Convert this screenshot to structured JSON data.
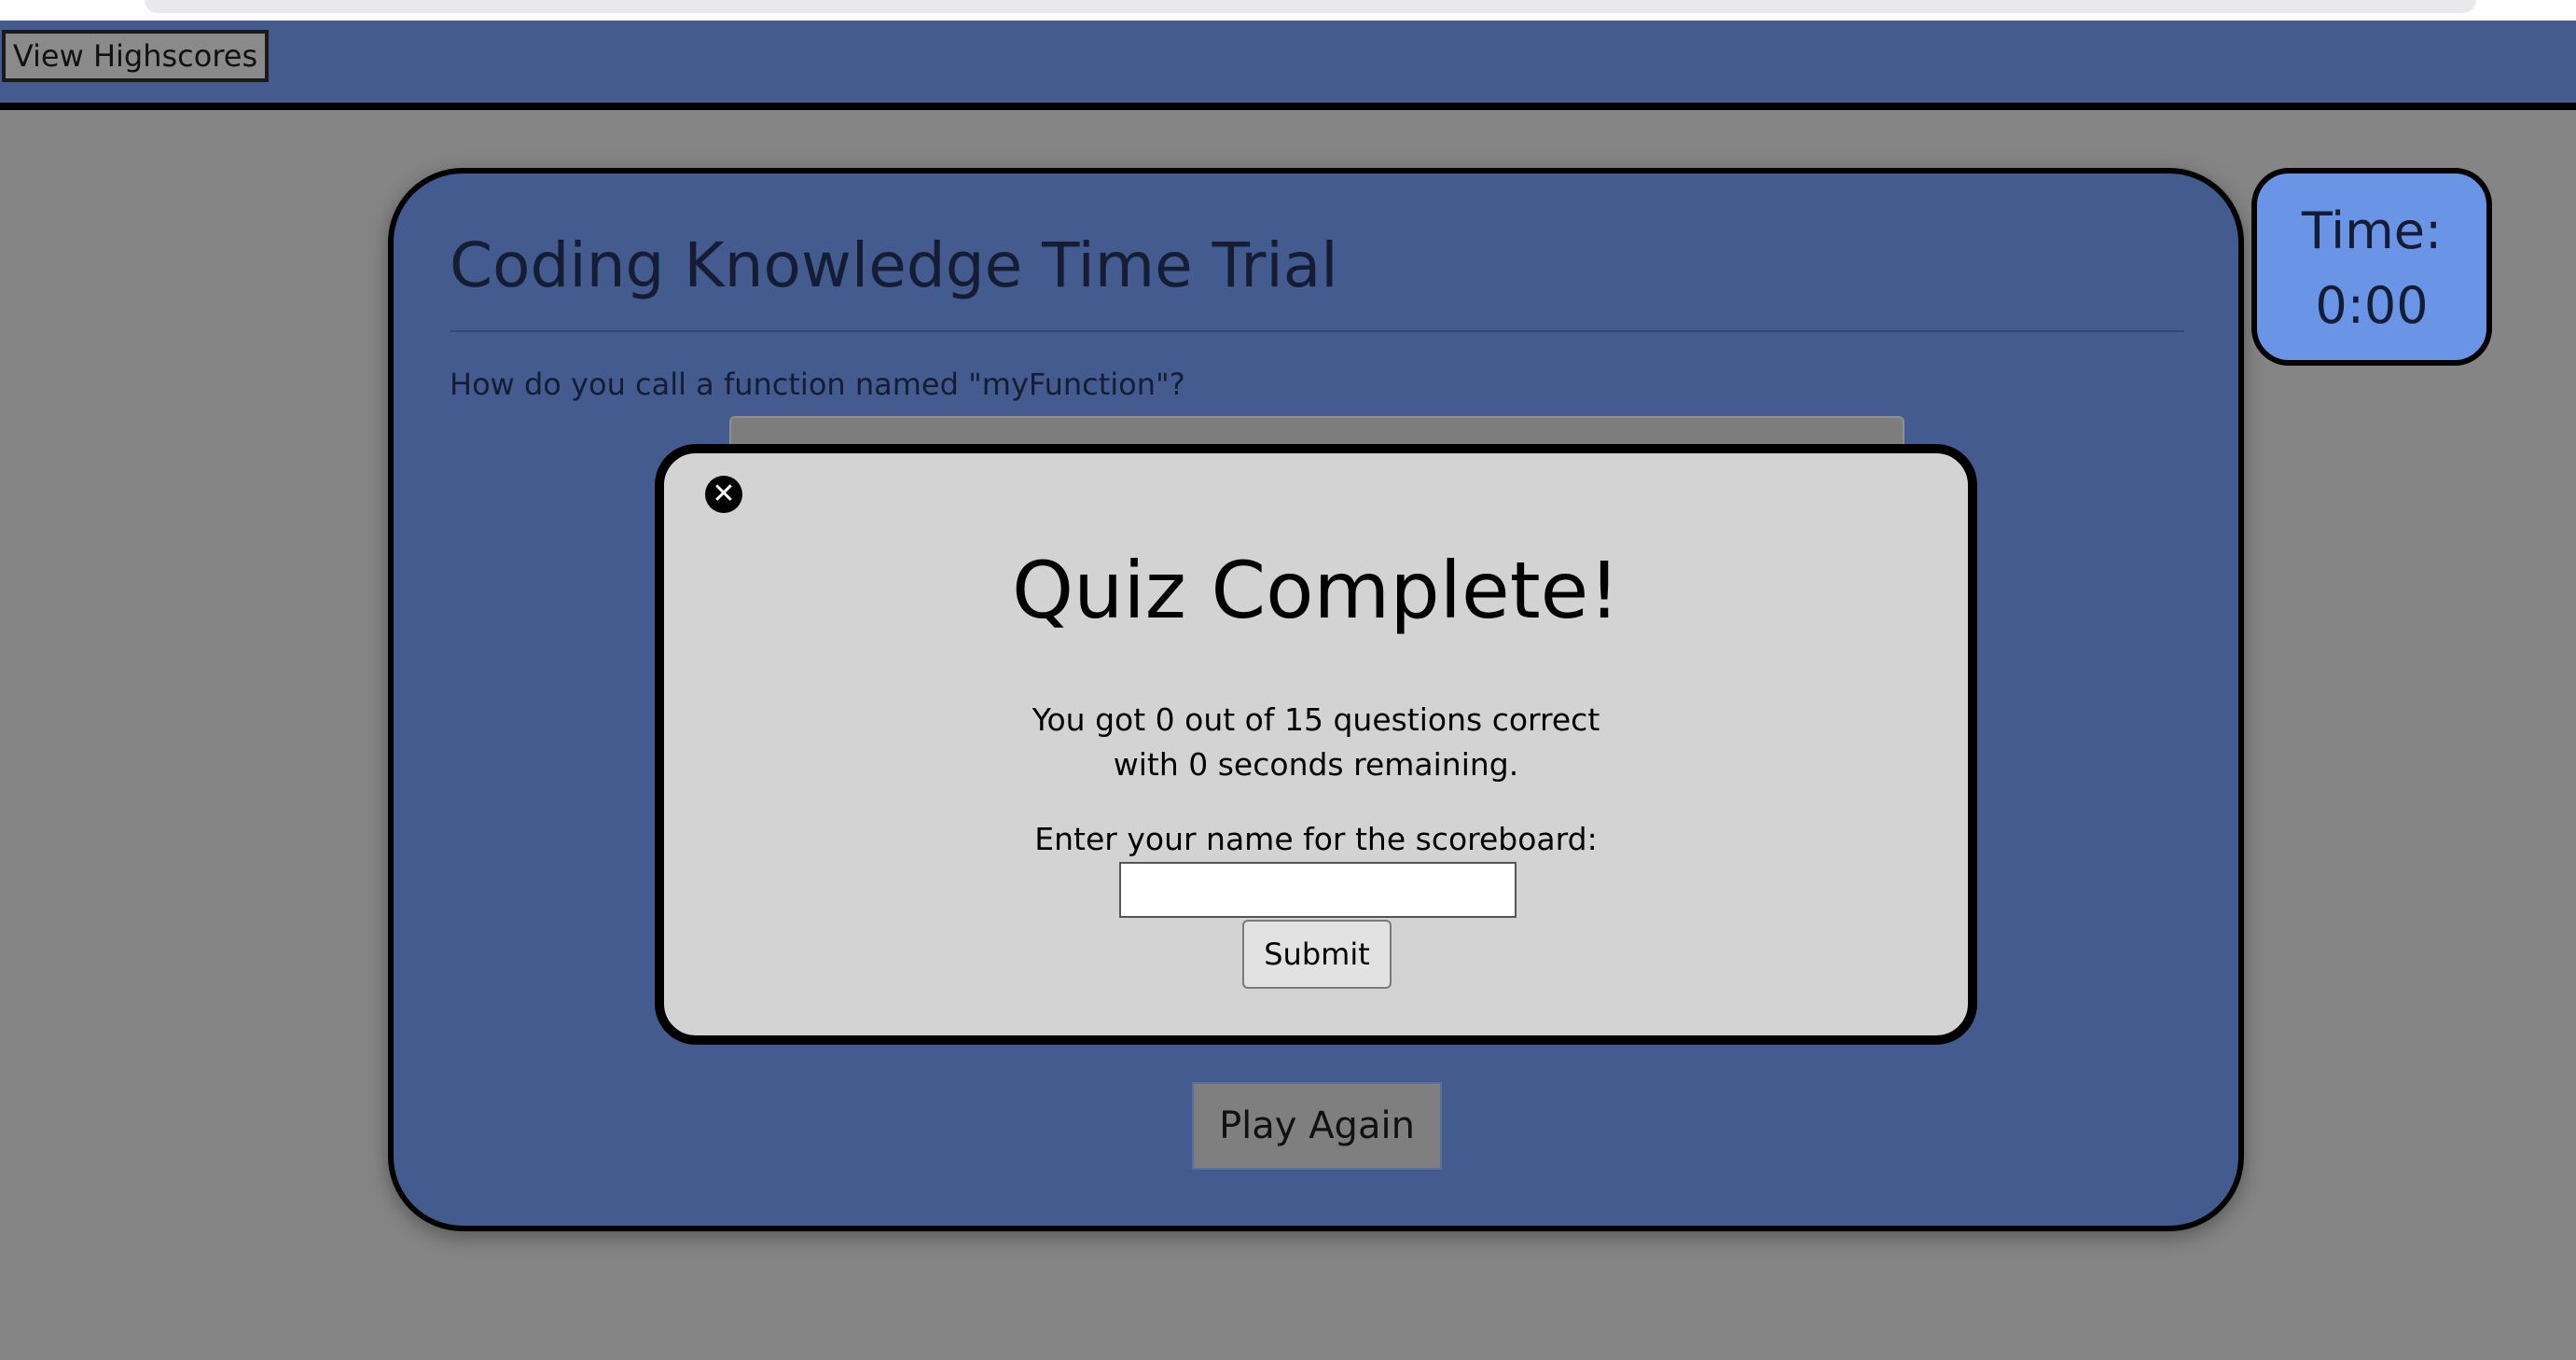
{
  "header": {
    "highscores_label": "View Highscores"
  },
  "quiz": {
    "title": "Coding Knowledge Time Trial",
    "question": "How do you call a function named \"myFunction\"?",
    "play_again_label": "Play Again"
  },
  "timer": {
    "label": "Time:",
    "value": "0:00"
  },
  "modal": {
    "close_icon": "close-icon",
    "close_glyph": "✕",
    "title": "Quiz Complete!",
    "result_line1": "You got 0 out of 15 questions correct",
    "result_line2": "with 0 seconds remaining.",
    "name_prompt": "Enter your name for the scoreboard:",
    "name_value": "",
    "submit_label": "Submit"
  },
  "colors": {
    "page_background": "#858585",
    "panel_blue": "#435b8e",
    "timer_blue": "#6a95e6",
    "modal_background": "#d3d3d3"
  }
}
